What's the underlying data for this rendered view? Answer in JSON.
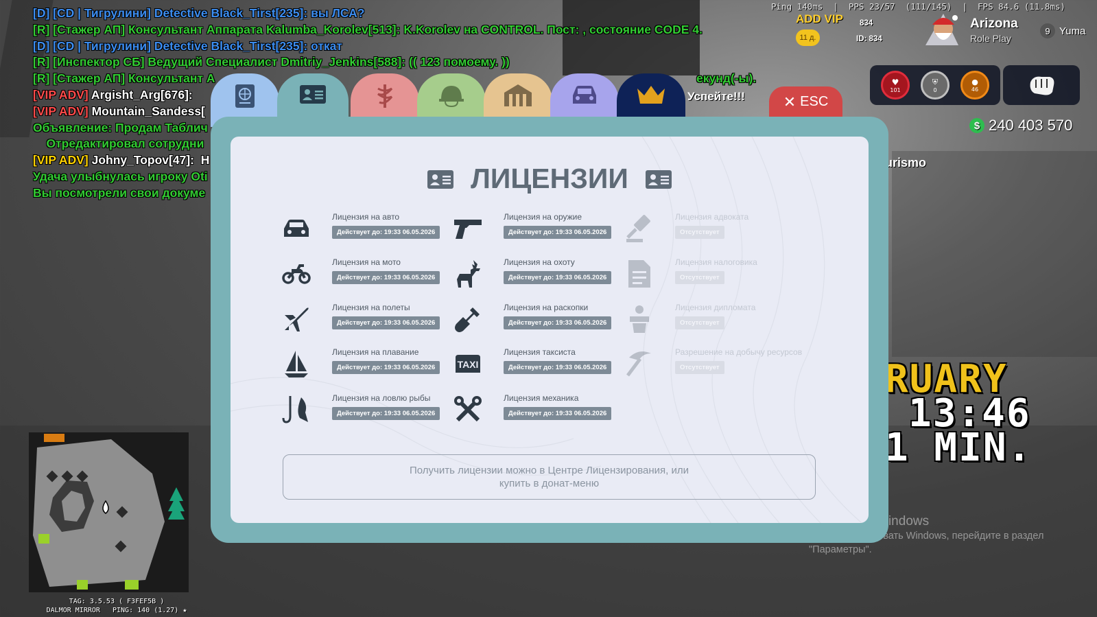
{
  "chat": [
    {
      "color": "blue",
      "text": "[D] [CD | Тигрулини] Detective Black_Tirst[235]: вы ЛСА?"
    },
    {
      "color": "green",
      "text": "[R] [Стажер АП] Консультант Аппарата Kalumba_Korolev[513]: K.Korolev на CONTROL. Пост: , состояние CODE 4."
    },
    {
      "color": "blue",
      "text": "[D] [CD | Тигрулини] Detective Black_Tirst[235]: откат"
    },
    {
      "color": "green",
      "text": "[R] [Инспектор СБ] Ведущий Специалист Dmitriy_Jenkins[588]: (( 123 помоему. ))"
    },
    {
      "color": "green",
      "text": "[R] [Стажер АП] Консультант А"
    },
    {
      "color": "red",
      "prefix": "[VIP ADV]",
      "text": " Argisht_Arg[676]: "
    },
    {
      "color": "red",
      "prefix": "[VIP ADV]",
      "text": " Mountain_Sandess["
    },
    {
      "color": "green",
      "text": "Объявление: Продам Таблич"
    },
    {
      "color": "green",
      "text": "    Отредактировал сотрудни"
    },
    {
      "color": "yellow",
      "prefix": "[VIP ADV]",
      "text": " Johny_Topov[47]:  H"
    },
    {
      "color": "green",
      "text": "Удача улыбнулась игроку Oti"
    },
    {
      "color": "green",
      "text": "Вы посмотрели свои докуме"
    }
  ],
  "chat_tail": "екунд(-ы).",
  "hud": {
    "perf": "Ping 140ms  |  PPS 23/57  (111/145)  |  FPS 84.6 (11.8ms)",
    "vip_label": "ADD VIP",
    "vip_days": "11 д.",
    "id_top": "834",
    "id_bottom": "ID: 834",
    "server_name": "Arizona",
    "server_sub": "Role Play",
    "server_num": "9",
    "server_city": "Yuma",
    "health": "101",
    "armor": "0",
    "hunger": "46",
    "money": "240 403 570",
    "turismo": "urismo",
    "big_month": "RUARY",
    "big_time": "13:46",
    "big_min": "1 MIN.",
    "win_title": "Активация Windows",
    "win_sub1": "Чтобы активировать Windows, перейдите в раздел",
    "win_sub2": "\"Параметры\"."
  },
  "minimap": {
    "tag": "TAG: 3.5.53 ( F3FEF5B )",
    "place": "DALMOR MIRROR",
    "ping": "PING: 140 (1.27) ★"
  },
  "tabs": [
    {
      "name": "passport",
      "color": "#9fc3ee",
      "icon": "passport-icon"
    },
    {
      "name": "licenses",
      "color": "#7ab2b7",
      "icon": "id-card-icon",
      "active": true
    },
    {
      "name": "medical",
      "color": "#e59494",
      "icon": "medical-icon"
    },
    {
      "name": "military",
      "color": "#a6cd8c",
      "icon": "helmet-icon"
    },
    {
      "name": "property",
      "color": "#e6c490",
      "icon": "house-icon"
    },
    {
      "name": "vehicles",
      "color": "#a7a4ec",
      "icon": "car-icon"
    },
    {
      "name": "donate",
      "color": "#0e2257",
      "icon": "crown-icon"
    }
  ],
  "hurry": "Успейте!!!",
  "esc_label": "ESC",
  "title": "ЛИЦЕНЗИИ",
  "licenses": [
    {
      "name": "Лицензия на авто",
      "status": "Действует до: 19:33 06.05.2026",
      "active": true,
      "icon": "car-icon"
    },
    {
      "name": "Лицензия на мото",
      "status": "Действует до: 19:33 06.05.2026",
      "active": true,
      "icon": "motorcycle-icon"
    },
    {
      "name": "Лицензия на полеты",
      "status": "Действует до: 19:33 06.05.2026",
      "active": true,
      "icon": "plane-icon"
    },
    {
      "name": "Лицензия на плавание",
      "status": "Действует до: 19:33 06.05.2026",
      "active": true,
      "icon": "sailboat-icon"
    },
    {
      "name": "Лицензия на ловлю рыбы",
      "status": "Действует до: 19:33 06.05.2026",
      "active": true,
      "icon": "fishing-icon"
    },
    {
      "name": "Лицензия на оружие",
      "status": "Действует до: 19:33 06.05.2026",
      "active": true,
      "icon": "pistol-icon"
    },
    {
      "name": "Лицензия на охоту",
      "status": "Действует до: 19:33 06.05.2026",
      "active": true,
      "icon": "deer-icon"
    },
    {
      "name": "Лицензия на раскопки",
      "status": "Действует до: 19:33 06.05.2026",
      "active": true,
      "icon": "shovel-icon"
    },
    {
      "name": "Лицензия таксиста",
      "status": "Действует до: 19:33 06.05.2026",
      "active": true,
      "icon": "taxi-icon"
    },
    {
      "name": "Лицензия механика",
      "status": "Действует до: 19:33 06.05.2026",
      "active": true,
      "icon": "tools-icon"
    },
    {
      "name": "Лицензия адвоката",
      "status": "Отсутствует",
      "active": false,
      "icon": "gavel-icon"
    },
    {
      "name": "Лицензия налоговика",
      "status": "Отсутствует",
      "active": false,
      "icon": "document-icon"
    },
    {
      "name": "Лицензия дипломата",
      "status": "Отсутствует",
      "active": false,
      "icon": "diplomat-icon"
    },
    {
      "name": "Разрешение на добычу ресурсов",
      "status": "Отсутствует",
      "active": false,
      "icon": "pickaxe-icon"
    }
  ],
  "note": "Получить лицензии можно в Центре Лицензирования, или купить в донат-меню"
}
